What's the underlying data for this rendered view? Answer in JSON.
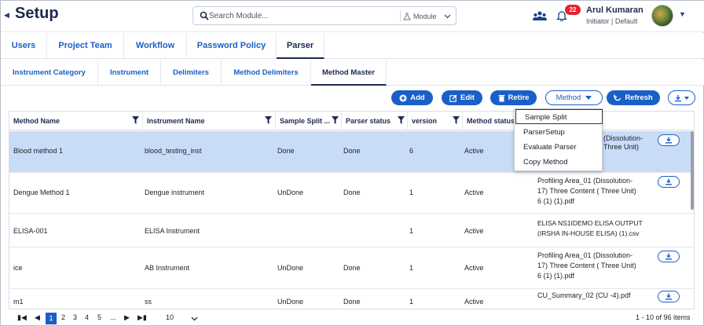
{
  "header": {
    "title": "Setup",
    "search_placeholder": "Search Module...",
    "module_label": "Module",
    "notification_count": "22",
    "user_name": "Arul Kumaran",
    "user_role": "Initiator | Default"
  },
  "tabs": [
    {
      "label": "Users"
    },
    {
      "label": "Project Team"
    },
    {
      "label": "Workflow"
    },
    {
      "label": "Password Policy"
    },
    {
      "label": "Parser"
    }
  ],
  "subtabs": [
    {
      "label": "Instrument Category"
    },
    {
      "label": "Instrument"
    },
    {
      "label": "Delimiters"
    },
    {
      "label": "Method Delimiters"
    },
    {
      "label": "Method Master"
    }
  ],
  "toolbar": {
    "add": "Add",
    "edit": "Edit",
    "retire": "Retire",
    "method": "Method",
    "refresh": "Refresh"
  },
  "dropdown": [
    "Sample Split",
    "ParserSetup",
    "Evaluate Parser",
    "Copy Method"
  ],
  "columns": [
    "Method Name",
    "Instrument Name",
    "Sample Split ...",
    "Parser status",
    "version",
    "Method status"
  ],
  "rows": [
    {
      "method": "Blood method 1",
      "instrument": "blood_testing_inst",
      "split": "Done",
      "parser": "Done",
      "version": "6",
      "status": "Active",
      "file_a": "(Dissolution-",
      "file_b": "Three Unit)"
    },
    {
      "method": "Dengue Method 1",
      "instrument": "Dengue instrument",
      "split": "UnDone",
      "parser": "Done",
      "version": "1",
      "status": "Active",
      "file_a": "Profiling Area_01 (Dissolution-",
      "file_b": "17) Three Content ( Three Unit)",
      "file_c": "6 (1) (1).pdf"
    },
    {
      "method": "ELISA-001",
      "instrument": "ELISA Instrument",
      "split": "",
      "parser": "",
      "version": "1",
      "status": "Active",
      "file_a": "ELISA NS1IDEMO ELISA OUTPUT",
      "file_b": "(IRSHA IN-HOUSE ELISA) (1).csv"
    },
    {
      "method": "ice",
      "instrument": "AB Instrument",
      "split": "UnDone",
      "parser": "Done",
      "version": "1",
      "status": "Active",
      "file_a": "Profiling Area_01 (Dissolution-",
      "file_b": "17) Three Content ( Three Unit)",
      "file_c": "6 (1) (1).pdf"
    },
    {
      "method": "m1",
      "instrument": "ss",
      "split": "UnDone",
      "parser": "Done",
      "version": "1",
      "status": "Active",
      "file_a": "CU_Summary_02 (CU -4).pdf"
    }
  ],
  "pager": {
    "pages": [
      "1",
      "2",
      "3",
      "4",
      "5",
      "..."
    ],
    "page_size": "10",
    "summary": "1 - 10 of 96 items"
  },
  "colors": {
    "primary": "#1a5fc7",
    "selected_row": "#c9dcf7",
    "badge": "#e5212d"
  }
}
